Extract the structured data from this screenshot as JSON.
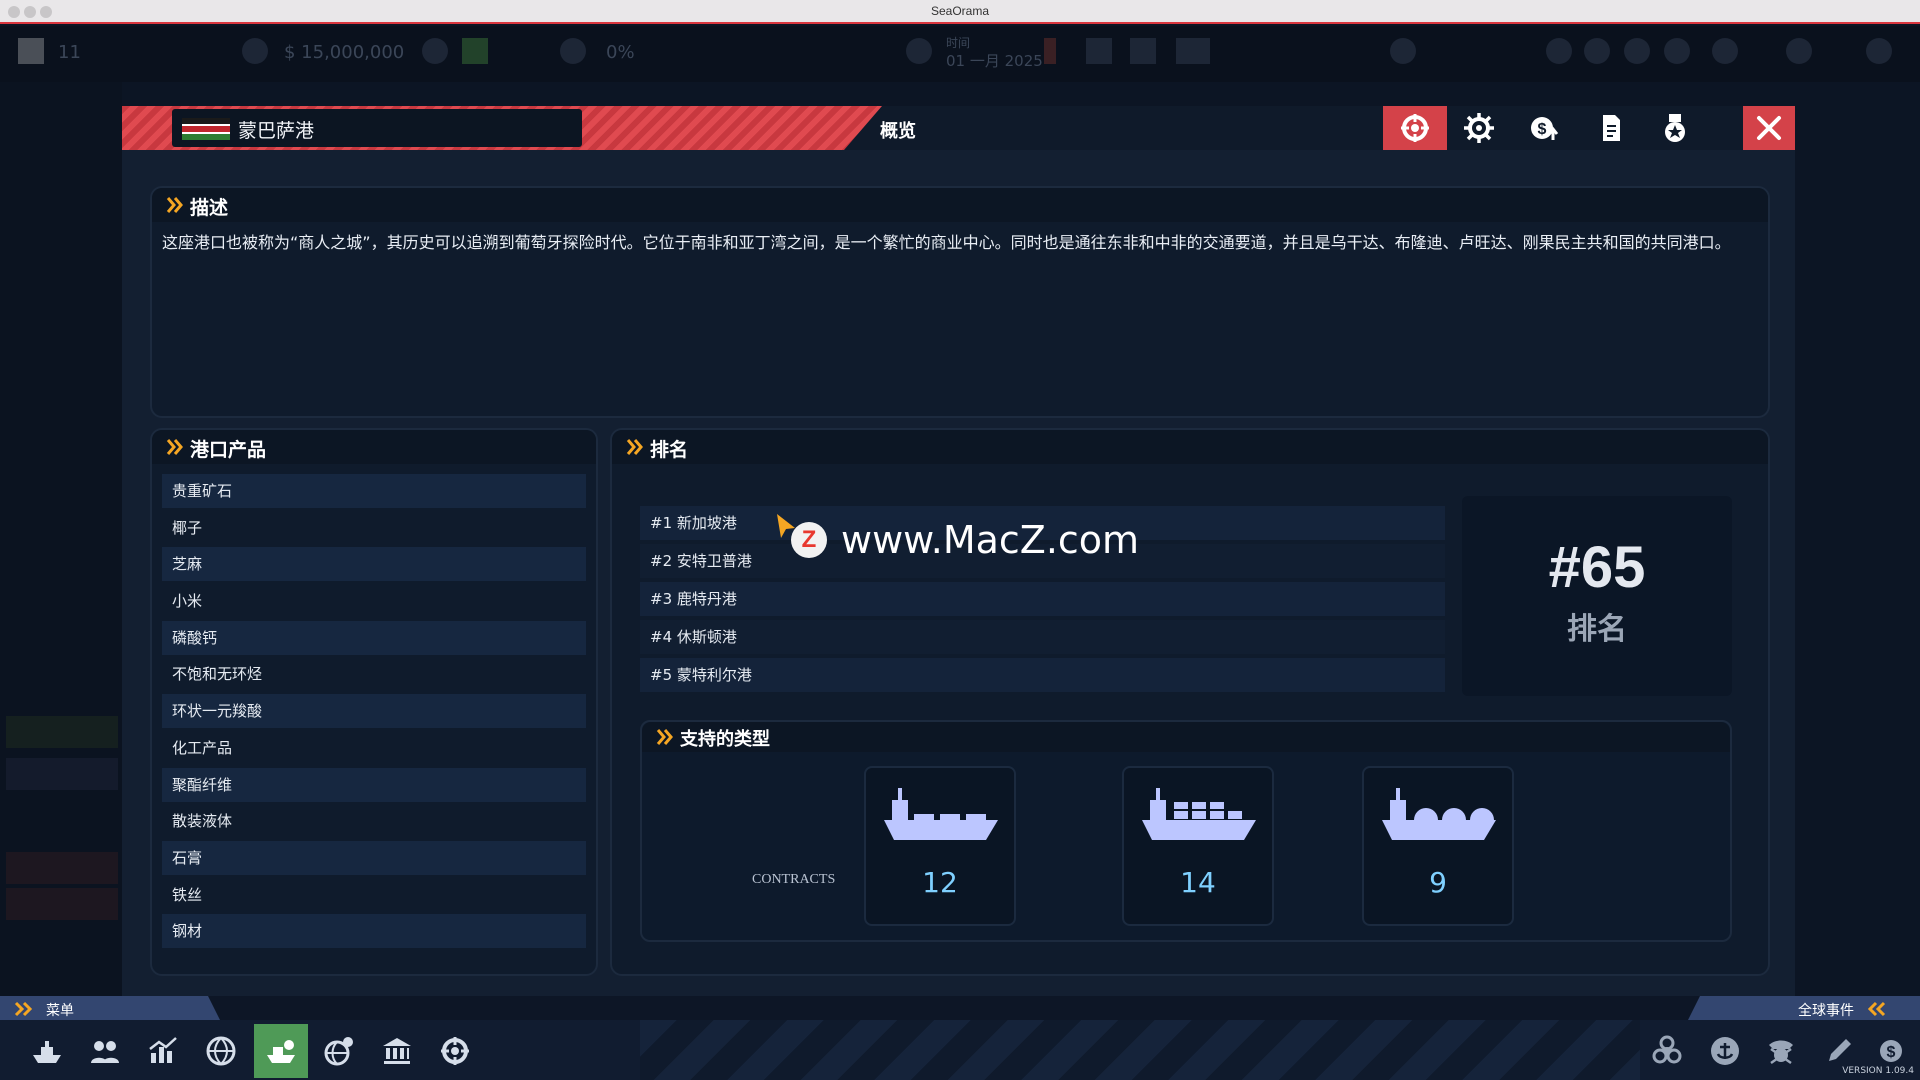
{
  "window": {
    "title": "SeaOrama"
  },
  "hud": {
    "level": "11",
    "money": "$ 15,000,000",
    "percent": "0%",
    "date_label": "时间",
    "date": "01 一月 2025"
  },
  "modal": {
    "port_name": "蒙巴萨港",
    "tab_title": "概览",
    "toolbar": [
      {
        "icon": "port-wheel-icon",
        "active": true
      },
      {
        "icon": "gear-icon",
        "active": false
      },
      {
        "icon": "money-up-icon",
        "active": false
      },
      {
        "icon": "document-icon",
        "active": false
      },
      {
        "icon": "medal-icon",
        "active": false
      }
    ],
    "description": {
      "title": "描述",
      "text": "这座港口也被称为“商人之城”，其历史可以追溯到葡萄牙探险时代。它位于南非和亚丁湾之间，是一个繁忙的商业中心。同时也是通往东非和中非的交通要道，并且是乌干达、布隆迪、卢旺达、刚果民主共和国的共同港口。"
    },
    "products": {
      "title": "港口产品",
      "items": [
        "贵重矿石",
        "椰子",
        "芝麻",
        "小米",
        "磷酸钙",
        "不饱和无环烃",
        "环状一元羧酸",
        "化工产品",
        "聚酯纤维",
        "散装液体",
        "石膏",
        "铁丝",
        "钢材"
      ]
    },
    "ranking": {
      "title": "排名",
      "list": [
        "#1 新加坡港",
        "#2 安特卫普港",
        "#3 鹿特丹港",
        "#4 休斯顿港",
        "#5 蒙特利尔港"
      ],
      "own_rank": "#65",
      "own_rank_label": "排名"
    },
    "supported_types": {
      "title": "支持的类型",
      "contracts_label": "CONTRACTS",
      "ships": [
        {
          "icon": "tanker-ship-icon",
          "count": "12"
        },
        {
          "icon": "container-ship-icon",
          "count": "14"
        },
        {
          "icon": "gas-carrier-ship-icon",
          "count": "9"
        }
      ]
    }
  },
  "watermark": {
    "text": "www.MacZ.com",
    "badge": "Z"
  },
  "bottom": {
    "menu_label": "菜单",
    "events_label": "全球事件",
    "version": "VERSION 1.09.4",
    "nav": [
      "ship-icon",
      "people-icon",
      "chart-icon",
      "globe-icon",
      "ship-selected-icon",
      "globe-gear-icon",
      "bank-icon",
      "port-wheel-icon"
    ],
    "right_icons": [
      "biohazard-icon",
      "anchor-icon",
      "pirate-icon",
      "pen-icon",
      "money-icon"
    ]
  },
  "colors": {
    "accent_red": "#d44249",
    "panel_bg": "#0f1b2c",
    "highlight_green": "#4f9a57",
    "ship_lavender": "#bcc6ff",
    "count_blue": "#7fd0ff"
  }
}
